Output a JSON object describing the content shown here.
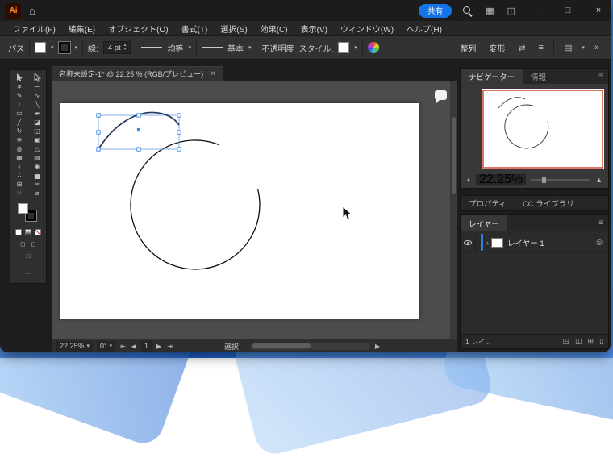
{
  "app": {
    "logo_text": "Ai"
  },
  "titlebar": {
    "share_label": "共有",
    "home_glyph": "⌂",
    "workspace_glyph": "▦",
    "panels_glyph": "◫",
    "minimize_glyph": "−",
    "maximize_glyph": "□",
    "close_glyph": "×"
  },
  "menubar": {
    "items": [
      "ファイル(F)",
      "編集(E)",
      "オブジェクト(O)",
      "書式(T)",
      "選択(S)",
      "効果(C)",
      "表示(V)",
      "ウィンドウ(W)",
      "ヘルプ(H)"
    ]
  },
  "control_bar": {
    "context_label": "パス",
    "stroke_label": "線:",
    "stroke_weight": "4 pt",
    "profile_label": "均等",
    "brush_label": "基本",
    "opacity_label": "不透明度",
    "style_label": "スタイル:",
    "align_label": "整列",
    "transform_label": "変形",
    "dropdown_glyph": "▾",
    "up_glyph": "▴",
    "swap_glyph": "⇄",
    "menu_glyph": "≡",
    "grid_glyph": "▤",
    "collapse_glyph": "»"
  },
  "document": {
    "tab_title": "名称未設定-1* @ 22.25 % (RGB/プレビュー)",
    "close_glyph": "×"
  },
  "toolbar": {
    "tools": [
      {
        "name": "selection-tool",
        "glyph": ""
      },
      {
        "name": "direct-selection-tool",
        "glyph": ""
      },
      {
        "name": "magic-wand-tool",
        "glyph": "∗"
      },
      {
        "name": "lasso-tool",
        "glyph": "∽"
      },
      {
        "name": "pen-tool",
        "glyph": "✎"
      },
      {
        "name": "curvature-tool",
        "glyph": "∿"
      },
      {
        "name": "type-tool",
        "glyph": "T"
      },
      {
        "name": "line-segment-tool",
        "glyph": "╲"
      },
      {
        "name": "rectangle-tool",
        "glyph": "▭"
      },
      {
        "name": "paintbrush-tool",
        "glyph": "▰"
      },
      {
        "name": "pencil-tool",
        "glyph": "╱"
      },
      {
        "name": "eraser-tool",
        "glyph": "◪"
      },
      {
        "name": "rotate-tool",
        "glyph": "↻"
      },
      {
        "name": "scale-tool",
        "glyph": "◱"
      },
      {
        "name": "width-tool",
        "glyph": "≋"
      },
      {
        "name": "free-transform-tool",
        "glyph": "▣"
      },
      {
        "name": "shape-builder-tool",
        "glyph": "◍"
      },
      {
        "name": "perspective-grid-tool",
        "glyph": "△"
      },
      {
        "name": "mesh-tool",
        "glyph": "▦"
      },
      {
        "name": "gradient-tool",
        "glyph": "▤"
      },
      {
        "name": "eyedropper-tool",
        "glyph": "∤"
      },
      {
        "name": "blend-tool",
        "glyph": "◉"
      },
      {
        "name": "symbol-sprayer-tool",
        "glyph": "∴"
      },
      {
        "name": "column-graph-tool",
        "glyph": "▅"
      },
      {
        "name": "artboard-tool",
        "glyph": "⊞"
      },
      {
        "name": "slice-tool",
        "glyph": "✂"
      },
      {
        "name": "hand-tool",
        "glyph": "☞"
      },
      {
        "name": "zoom-tool",
        "glyph": "⌀"
      }
    ],
    "mode_glyph_a": "◻",
    "mode_glyph_b": "◻",
    "screen_glyph": "□",
    "more_glyph": "⋯"
  },
  "navigator": {
    "tab_navigator": "ナビゲーター",
    "tab_info": "情報",
    "zoom_value": "22.25%",
    "zoom_out_glyph": "▲",
    "zoom_in_glyph": "▲",
    "menu_glyph": "≡"
  },
  "panels": {
    "properties_tab": "プロパティ",
    "libraries_tab": "CC ライブラリ"
  },
  "layers": {
    "tab": "レイヤー",
    "layer1_name": "レイヤー 1",
    "chevron_glyph": "›",
    "target_glyph": "◎",
    "footer_count": "1 レイ...",
    "footer_icons": [
      "◳",
      "◫",
      "⊞",
      "▯"
    ],
    "menu_glyph": "≡"
  },
  "statusbar": {
    "zoom_value": "22.25%",
    "rotation_value": "0°",
    "first_glyph": "⇤",
    "prev_glyph": "◀",
    "artboard_value": "1",
    "next_glyph": "▶",
    "last_glyph": "⇥",
    "dropdown_glyph": "▾",
    "tool_label": "選択",
    "expand_glyph": "▶"
  },
  "colors": {
    "accent_blue": "#1473e6",
    "selection_blue": "#3f8ae0",
    "artboard_proxy_red": "#d03a23"
  }
}
